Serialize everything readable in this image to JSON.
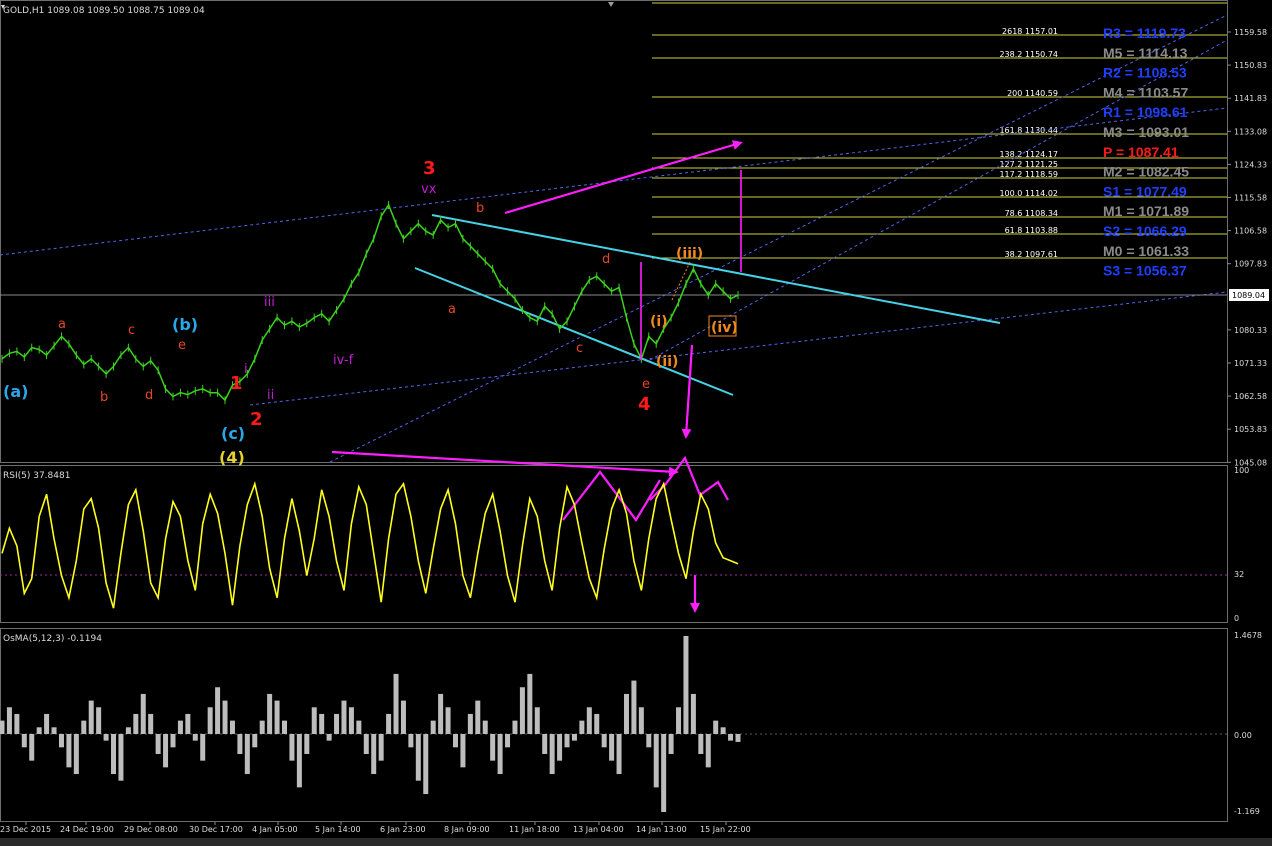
{
  "window": {
    "header": "GOLD,H1  1089.08 1089.50 1088.75 1089.04"
  },
  "main_panel": {
    "current_price": "1089.04",
    "price_axis_labels": [
      "1159.58",
      "1150.83",
      "1141.83",
      "1133.08",
      "1124.33",
      "1115.58",
      "1106.58",
      "1097.83",
      "1089.04",
      "1080.33",
      "1071.33",
      "1062.58",
      "1053.83",
      "1045.08"
    ],
    "fib_levels": [
      "2618 1157.01",
      "238.2 1150.74",
      "200 1140.59",
      "161.8 1130.44",
      "138.2 1124.17",
      "127.2 1121.25",
      "117.2 1118.59",
      "100.0 1114.02",
      "78.6 1108.34",
      "61.8 1103.88",
      "38.2 1097.61"
    ],
    "pivots": [
      {
        "text": "R3 = 1119.73",
        "color": "#1f3fff"
      },
      {
        "text": "M5 = 1114.13",
        "color": "#8a8a8a"
      },
      {
        "text": "R2 = 1108.53",
        "color": "#1f3fff"
      },
      {
        "text": "M4 = 1103.57",
        "color": "#8a8a8a"
      },
      {
        "text": "R1 = 1098.61",
        "color": "#1f3fff"
      },
      {
        "text": "M3 = 1093.01",
        "color": "#8a8a8a"
      },
      {
        "text": "P  = 1087.41",
        "color": "#ff1a1a"
      },
      {
        "text": "M2 = 1082.45",
        "color": "#8a8a8a"
      },
      {
        "text": "S1 = 1077.49",
        "color": "#1f3fff"
      },
      {
        "text": "M1 = 1071.89",
        "color": "#8a8a8a"
      },
      {
        "text": "S2 = 1066.29",
        "color": "#1f3fff"
      },
      {
        "text": "M0 = 1061.33",
        "color": "#8a8a8a"
      },
      {
        "text": "S3 = 1056.37",
        "color": "#1f3fff"
      }
    ],
    "wave_labels": {
      "a_blue": "(a)",
      "b_blue": "(b)",
      "c_blue": "(c)",
      "four_yellow": "(4)",
      "a1": "a",
      "b1": "b",
      "c1": "c",
      "d1": "d",
      "e1": "e",
      "one": "1",
      "two": "2",
      "three": "3",
      "four": "4",
      "i": "i",
      "ii": "ii",
      "iii": "iii",
      "ivf": "iv-f",
      "vx": "vx",
      "a2": "a",
      "b2": "b",
      "c2": "c",
      "d2": "d",
      "e2": "e",
      "w_i": "(i)",
      "w_ii": "(ii)",
      "w_iii": "(iii)",
      "w_iv": "(iv)"
    }
  },
  "rsi_panel": {
    "label": "RSI(5) 37.8481",
    "axis": [
      "100",
      "32",
      "0"
    ]
  },
  "osma_panel": {
    "label": "OsMA(5,12,3) -0.1194",
    "axis": [
      "1.4678",
      "0.00",
      "-1.169"
    ]
  },
  "time_axis": [
    "23 Dec 2015",
    "24 Dec 19:00",
    "29 Dec 08:00",
    "30 Dec 17:00",
    "4 Jan 05:00",
    "5 Jan 14:00",
    "6 Jan 23:00",
    "8 Jan 09:00",
    "11 Jan 18:00",
    "13 Jan 04:00",
    "14 Jan 13:00",
    "15 Jan 22:00"
  ],
  "colors": {
    "price": "#3cd21e",
    "rsi": "#ffff1e",
    "osma": "#bdbdbd",
    "channel": "#46d2e6",
    "dashed": "#5264e6",
    "annotation": "#ff1eff",
    "fib": "#d2d23c"
  },
  "chart_data": [
    {
      "type": "line",
      "title": "GOLD,H1",
      "series": [
        {
          "name": "GOLD",
          "values": [
            1072.0,
            1073.5,
            1074.0,
            1072.5,
            1075.0,
            1074.5,
            1073.0,
            1075.5,
            1078.0,
            1076.0,
            1073.0,
            1070.5,
            1072.0,
            1070.0,
            1068.0,
            1070.0,
            1073.0,
            1075.0,
            1072.0,
            1070.0,
            1071.5,
            1069.0,
            1064.0,
            1062.0,
            1063.0,
            1062.5,
            1063.5,
            1064.0,
            1063.0,
            1063.0,
            1061.0,
            1065.0,
            1066.0,
            1068.0,
            1072.0,
            1077.0,
            1080.0,
            1083.0,
            1081.0,
            1082.0,
            1080.5,
            1081.5,
            1083.0,
            1084.0,
            1082.0,
            1085.0,
            1088.0,
            1092.0,
            1095.0,
            1100.0,
            1104.0,
            1110.0,
            1113.0,
            1108.0,
            1104.0,
            1106.0,
            1108.0,
            1106.0,
            1105.0,
            1109.0,
            1107.0,
            1108.0,
            1104.0,
            1102.0,
            1100.0,
            1098.0,
            1096.0,
            1092.0,
            1090.0,
            1088.0,
            1085.0,
            1083.0,
            1082.0,
            1086.0,
            1084.0,
            1080.0,
            1082.0,
            1086.0,
            1090.0,
            1093.0,
            1094.0,
            1092.0,
            1090.0,
            1091.0,
            1083.0,
            1076.0,
            1072.0,
            1078.0,
            1076.0,
            1080.0,
            1083.0,
            1087.0,
            1092.0,
            1096.0,
            1092.0,
            1089.0,
            1092.0,
            1090.0,
            1088.0,
            1089.0
          ]
        }
      ],
      "ylim": [
        1045.08,
        1159.58
      ]
    },
    {
      "type": "line",
      "title": "RSI(5) 37.8481",
      "series": [
        {
          "name": "RSI(5)",
          "values": [
            45,
            62,
            50,
            18,
            28,
            70,
            85,
            55,
            30,
            15,
            40,
            75,
            82,
            62,
            25,
            8,
            45,
            78,
            88,
            60,
            25,
            15,
            55,
            80,
            70,
            40,
            20,
            65,
            85,
            72,
            45,
            10,
            50,
            78,
            92,
            70,
            35,
            15,
            55,
            82,
            60,
            30,
            55,
            88,
            70,
            40,
            20,
            65,
            90,
            78,
            45,
            12,
            55,
            85,
            92,
            70,
            40,
            18,
            48,
            75,
            88,
            65,
            30,
            15,
            45,
            72,
            85,
            60,
            30,
            12,
            50,
            82,
            70,
            40,
            20,
            62,
            90,
            78,
            52,
            28,
            15,
            48,
            75,
            88,
            72,
            40,
            20,
            55,
            82,
            92,
            68,
            45,
            28,
            60,
            85,
            75,
            52,
            42,
            40,
            38
          ]
        }
      ],
      "ylim": [
        0,
        100
      ]
    },
    {
      "type": "bar",
      "title": "OsMA(5,12,3) -0.1194",
      "series": [
        {
          "name": "OsMA",
          "values": [
            0.2,
            0.4,
            0.3,
            -0.2,
            -0.4,
            0.1,
            0.3,
            0.1,
            -0.2,
            -0.5,
            -0.6,
            0.2,
            0.5,
            0.4,
            -0.1,
            -0.6,
            -0.7,
            0.1,
            0.3,
            0.6,
            0.3,
            -0.3,
            -0.5,
            -0.2,
            0.2,
            0.3,
            -0.1,
            -0.4,
            0.4,
            0.7,
            0.5,
            0.2,
            -0.3,
            -0.6,
            -0.2,
            0.2,
            0.6,
            0.5,
            0.2,
            -0.4,
            -0.8,
            -0.3,
            0.4,
            0.3,
            -0.1,
            0.3,
            0.5,
            0.4,
            0.2,
            -0.3,
            -0.6,
            -0.4,
            0.3,
            0.9,
            0.5,
            -0.2,
            -0.7,
            -0.9,
            0.2,
            0.6,
            0.4,
            -0.2,
            -0.5,
            0.3,
            0.5,
            0.2,
            -0.4,
            -0.6,
            -0.2,
            0.2,
            0.7,
            0.9,
            0.4,
            -0.3,
            -0.6,
            -0.4,
            -0.2,
            -0.1,
            0.2,
            0.4,
            0.3,
            -0.2,
            -0.4,
            -0.6,
            0.6,
            0.8,
            0.4,
            -0.2,
            -0.8,
            -1.169,
            -0.3,
            0.4,
            1.4678,
            0.6,
            -0.3,
            -0.5,
            0.2,
            0.1,
            -0.1,
            -0.1194
          ]
        }
      ],
      "ylim": [
        -1.169,
        1.4678
      ]
    }
  ]
}
